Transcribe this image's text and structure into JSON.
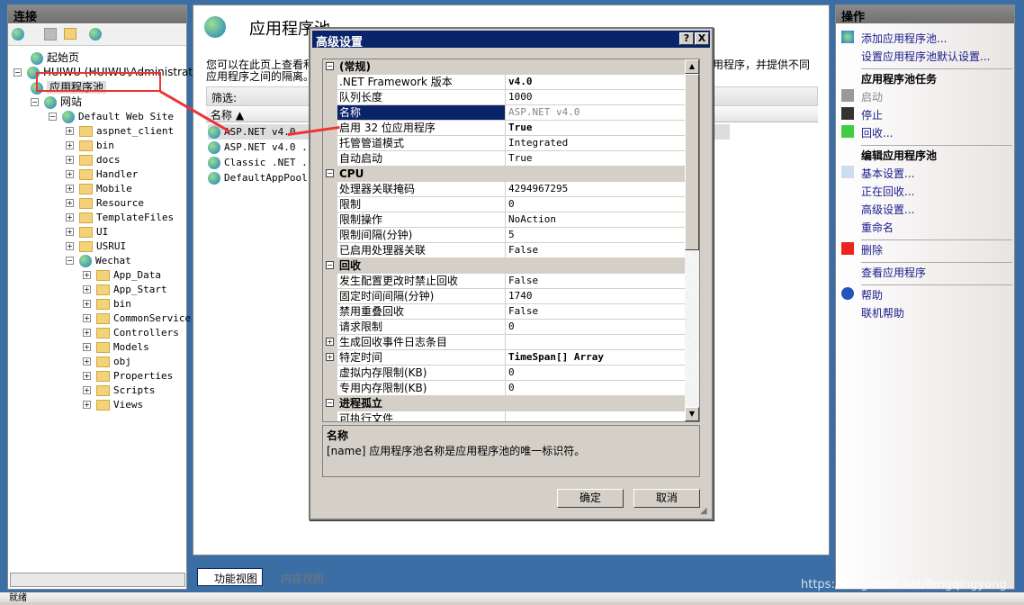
{
  "connections": {
    "title": "连接",
    "tree": [
      {
        "label": "起始页",
        "level": 1
      },
      {
        "label": "HUIWU (HUIWU\\Administrator)",
        "level": 0,
        "expanded": true
      },
      {
        "label": "应用程序池",
        "level": 1,
        "selected": true
      },
      {
        "label": "网站",
        "level": 1,
        "expanded": true
      },
      {
        "label": "Default Web Site",
        "level": 2,
        "expanded": true
      },
      {
        "label": "aspnet_client",
        "level": 3
      },
      {
        "label": "bin",
        "level": 3
      },
      {
        "label": "docs",
        "level": 3
      },
      {
        "label": "Handler",
        "level": 3
      },
      {
        "label": "Mobile",
        "level": 3
      },
      {
        "label": "Resource",
        "level": 3
      },
      {
        "label": "TemplateFiles",
        "level": 3
      },
      {
        "label": "UI",
        "level": 3
      },
      {
        "label": "USRUI",
        "level": 3
      },
      {
        "label": "Wechat",
        "level": 3,
        "expanded": true
      },
      {
        "label": "App_Data",
        "level": 4
      },
      {
        "label": "App_Start",
        "level": 4
      },
      {
        "label": "bin",
        "level": 4
      },
      {
        "label": "CommonService",
        "level": 4
      },
      {
        "label": "Controllers",
        "level": 4
      },
      {
        "label": "Models",
        "level": 4
      },
      {
        "label": "obj",
        "level": 4
      },
      {
        "label": "Properties",
        "level": 4
      },
      {
        "label": "Scripts",
        "level": 4
      },
      {
        "label": "Views",
        "level": 4
      }
    ]
  },
  "center": {
    "title": "应用程序池",
    "desc1a": "您可以在此页上查看和",
    "desc1b": "用程序，并提供不同",
    "desc2": "应用程序之间的隔离。",
    "filter_label": "筛选:",
    "col_name": "名称",
    "pools": [
      "ASP.NET v4.0",
      "ASP.NET v4.0 ...",
      "Classic .NET ...",
      "DefaultAppPool"
    ],
    "view_tabs": [
      "功能视图",
      "内容视图"
    ]
  },
  "dialog": {
    "title": "高级设置",
    "help": "?",
    "close": "X",
    "rows": [
      {
        "cat": true,
        "name": "(常规)",
        "exp": "⊟"
      },
      {
        "name": ".NET Framework 版本",
        "value": "v4.0",
        "bold": true
      },
      {
        "name": "队列长度",
        "value": "1000"
      },
      {
        "name": "名称",
        "value": "ASP.NET v4.0",
        "selected": true
      },
      {
        "name": "启用 32 位应用程序",
        "value": "True",
        "bold": true
      },
      {
        "name": "托管管道模式",
        "value": "Integrated"
      },
      {
        "name": "自动启动",
        "value": "True"
      },
      {
        "cat": true,
        "name": "CPU",
        "exp": "⊟"
      },
      {
        "name": "处理器关联掩码",
        "value": "4294967295"
      },
      {
        "name": "限制",
        "value": "0"
      },
      {
        "name": "限制操作",
        "value": "NoAction"
      },
      {
        "name": "限制间隔(分钟)",
        "value": "5"
      },
      {
        "name": "已启用处理器关联",
        "value": "False"
      },
      {
        "cat": true,
        "name": "回收",
        "exp": "⊟"
      },
      {
        "name": "发生配置更改时禁止回收",
        "value": "False"
      },
      {
        "name": "固定时间间隔(分钟)",
        "value": "1740"
      },
      {
        "name": "禁用重叠回收",
        "value": "False"
      },
      {
        "name": "请求限制",
        "value": "0"
      },
      {
        "name": "生成回收事件日志条目",
        "value": "",
        "exp": "+"
      },
      {
        "name": "特定时间",
        "value": "TimeSpan[] Array",
        "bold": true,
        "exp": "+"
      },
      {
        "name": "虚拟内存限制(KB)",
        "value": "0"
      },
      {
        "name": "专用内存限制(KB)",
        "value": "0"
      },
      {
        "cat": true,
        "name": "进程孤立",
        "exp": "⊟"
      },
      {
        "name": "可执行文件",
        "value": ""
      }
    ],
    "desc_title": "名称",
    "desc_text": "[name] 应用程序池名称是应用程序池的唯一标识符。",
    "ok": "确定",
    "cancel": "取消"
  },
  "actions": {
    "title": "操作",
    "items": [
      {
        "t": "link",
        "label": "添加应用程序池...",
        "icon": "add-pool-icon"
      },
      {
        "t": "link",
        "label": "设置应用程序池默认设置..."
      },
      {
        "t": "sep"
      },
      {
        "t": "head",
        "label": "应用程序池任务"
      },
      {
        "t": "link",
        "label": "启动",
        "icon": "play-icon",
        "disabled": true
      },
      {
        "t": "link",
        "label": "停止",
        "icon": "stop-icon"
      },
      {
        "t": "link",
        "label": "回收...",
        "icon": "recycle-icon"
      },
      {
        "t": "sep"
      },
      {
        "t": "head",
        "label": "编辑应用程序池"
      },
      {
        "t": "link",
        "label": "基本设置...",
        "icon": "settings-icon"
      },
      {
        "t": "link",
        "label": "正在回收..."
      },
      {
        "t": "link",
        "label": "高级设置..."
      },
      {
        "t": "link",
        "label": "重命名"
      },
      {
        "t": "sep"
      },
      {
        "t": "link",
        "label": "删除",
        "icon": "delete-icon"
      },
      {
        "t": "sep"
      },
      {
        "t": "link",
        "label": "查看应用程序"
      },
      {
        "t": "sep"
      },
      {
        "t": "link",
        "label": "帮助",
        "icon": "help-icon"
      },
      {
        "t": "link",
        "label": "联机帮助"
      }
    ]
  },
  "status": "就绪",
  "watermark": "https://blog.csdn.net/fengqingyong",
  "colors": {
    "title_bar": "#0a246a",
    "link": "#1a1a8c",
    "annotation": "#ee3333"
  }
}
